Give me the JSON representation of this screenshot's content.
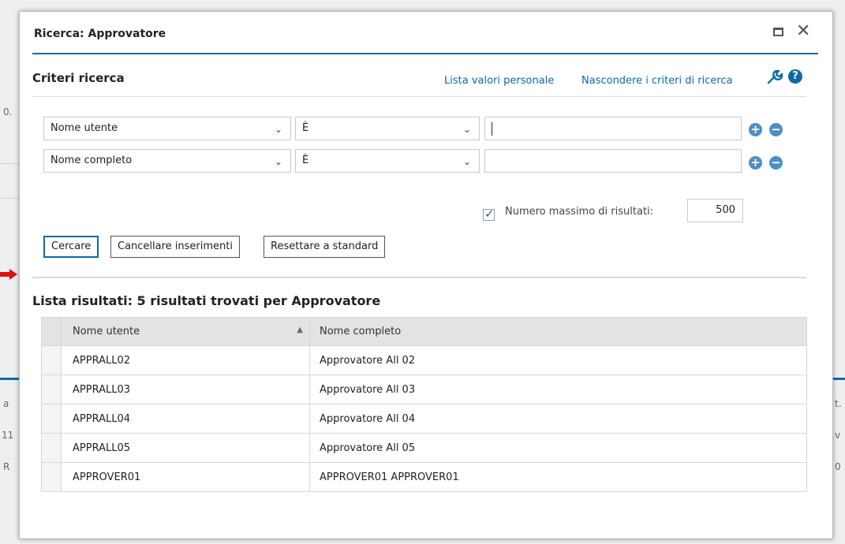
{
  "background": {
    "fragments": [
      "0.",
      "a",
      "11",
      "R",
      "t.",
      "v",
      "0"
    ]
  },
  "dialog": {
    "title": "Ricerca: Approvatore",
    "maximize_icon": "maximize-icon",
    "close_glyph": "✕"
  },
  "criteria": {
    "title": "Criteri ricerca",
    "link_personal": "Lista valori personale",
    "link_hide": "Nascondere i criteri di ricerca",
    "help_glyph": "?",
    "rows": [
      {
        "field": "Nome utente",
        "operator": "È",
        "value": ""
      },
      {
        "field": "Nome completo",
        "operator": "È",
        "value": ""
      }
    ],
    "max_results_label": "Numero massimo di risultati:",
    "max_results_value": "500",
    "max_results_checked": true
  },
  "buttons": {
    "search": "Cercare",
    "clear": "Cancellare inserimenti",
    "reset": "Resettare a standard"
  },
  "results": {
    "title": "Lista risultati: 5 risultati trovati per Approvatore",
    "columns": [
      "Nome utente",
      "Nome completo"
    ],
    "rows": [
      [
        "APPRALL02",
        "Approvatore All 02"
      ],
      [
        "APPRALL03",
        "Approvatore All 03"
      ],
      [
        "APPRALL04",
        "Approvatore All 04"
      ],
      [
        "APPRALL05",
        "Approvatore All 05"
      ],
      [
        "APPROVER01",
        "APPROVER01 APPROVER01"
      ]
    ]
  },
  "colors": {
    "accent": "#0c6aa6",
    "icon_blue": "#4b8fc6",
    "arrow": "#e01010"
  }
}
